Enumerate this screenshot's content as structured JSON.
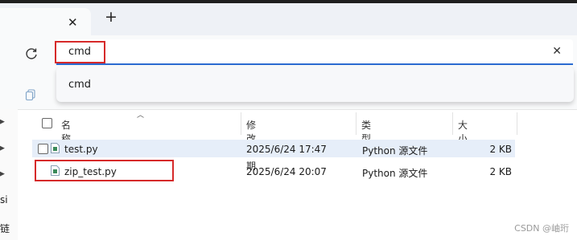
{
  "tabbar": {
    "close_glyph": "✕",
    "new_tab_glyph": "+"
  },
  "addressbar": {
    "value": "cmd",
    "clear_glyph": "✕"
  },
  "suggestions": [
    {
      "label": "cmd"
    }
  ],
  "columns": {
    "name": "名称",
    "modified": "修改日期",
    "type": "类型",
    "size": "大小"
  },
  "files": [
    {
      "name": "test.py",
      "modified": "2025/6/24 17:47",
      "type": "Python 源文件",
      "size": "2 KB"
    },
    {
      "name": "zip_test.py",
      "modified": "2025/6/24 20:07",
      "type": "Python 源文件",
      "size": "2 KB"
    }
  ],
  "navpane": {
    "fragment_1": "si",
    "fragment_2": "链"
  },
  "watermark": "CSDN @岫珩",
  "colors": {
    "accent": "#2a6bd1",
    "highlight": "#d62a2a",
    "selected_row": "#e6eef9"
  },
  "icons": [
    "refresh-icon",
    "copy-icon",
    "python-file-icon",
    "chevron-right-icon",
    "sort-ascending-icon"
  ]
}
